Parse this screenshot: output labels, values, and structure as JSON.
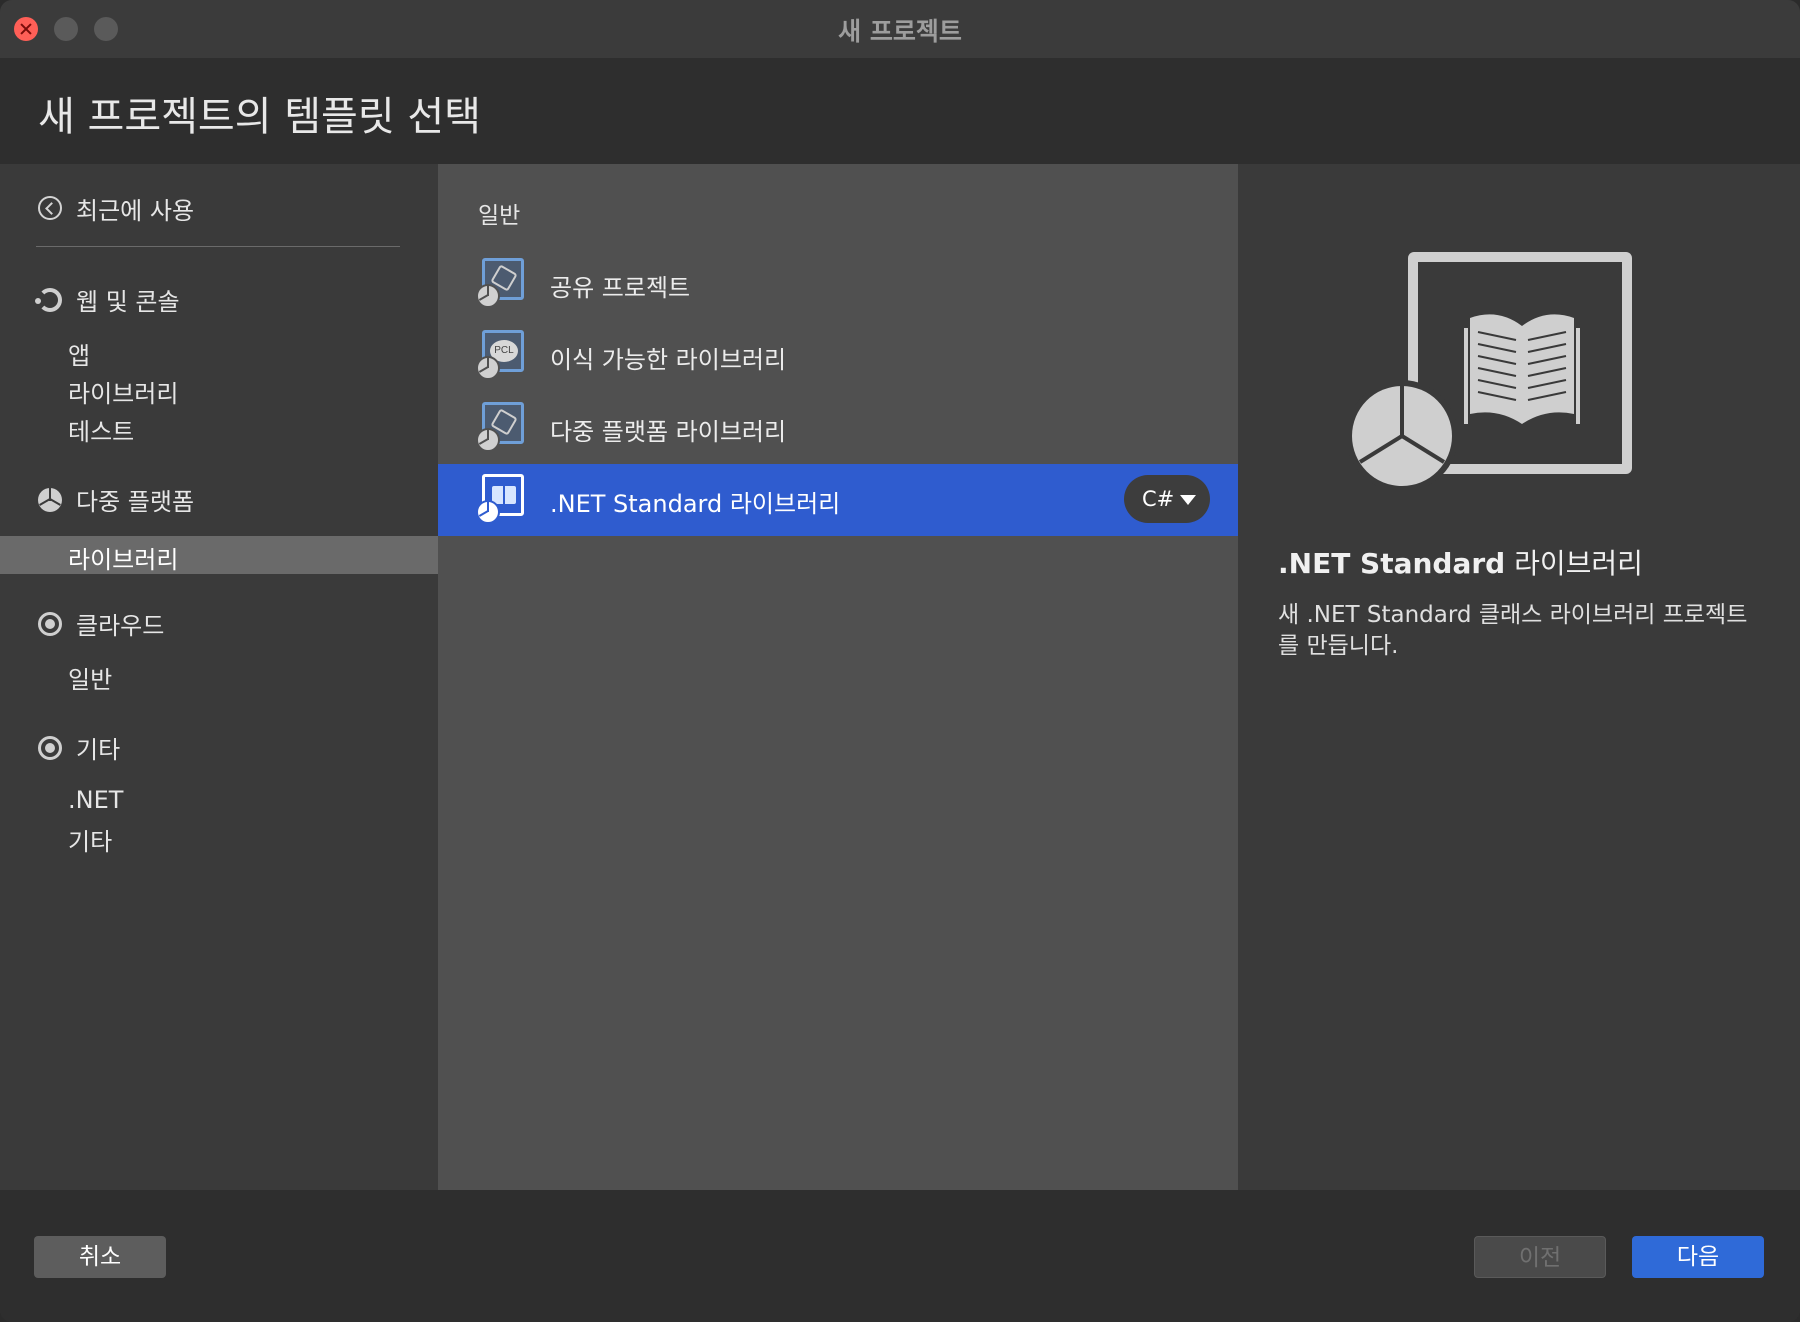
{
  "window": {
    "title": "새 프로젝트"
  },
  "header": {
    "title": "새 프로젝트의 템플릿 선택"
  },
  "sidebar": {
    "recent_label": "최근에 사용",
    "categories": [
      {
        "label": "웹 및 콘솔",
        "icon": "refresh-icon",
        "items": [
          "앱",
          "라이브러리",
          "테스트"
        ]
      },
      {
        "label": "다중 플랫폼",
        "icon": "pie-icon",
        "items": [
          "라이브러리"
        ]
      },
      {
        "label": "클라우드",
        "icon": "ring-icon",
        "items": [
          "일반"
        ]
      },
      {
        "label": "기타",
        "icon": "ring-icon",
        "items": [
          ".NET",
          "기타"
        ]
      }
    ],
    "selected_item": "라이브러리"
  },
  "templates": {
    "section_label": "일반",
    "items": [
      {
        "label": "공유 프로젝트",
        "icon": "shared-project-icon"
      },
      {
        "label": "이식 가능한 라이브러리",
        "icon": "pcl-icon",
        "badge": "PCL"
      },
      {
        "label": "다중 플랫폼 라이브러리",
        "icon": "multiplatform-library-icon"
      },
      {
        "label": ".NET Standard 라이브러리",
        "icon": "book-icon"
      }
    ],
    "selected_index": 3,
    "language": "C#"
  },
  "detail": {
    "title_bold": ".NET Standard",
    "title_rest": " 라이브러리",
    "description": "새 .NET Standard 클래스 라이브러리 프로젝트를 만듭니다."
  },
  "footer": {
    "cancel_label": "취소",
    "prev_label": "이전",
    "next_label": "다음"
  },
  "colors": {
    "accent": "#2f5ccf",
    "primary_button": "#2f6ad8",
    "close_button": "#ff5f57"
  }
}
